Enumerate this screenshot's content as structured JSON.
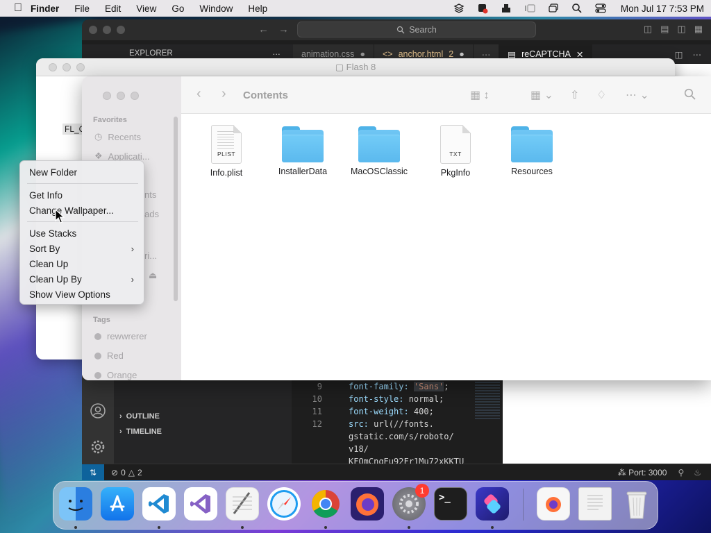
{
  "menubar": {
    "app": "Finder",
    "items": [
      "File",
      "Edit",
      "View",
      "Go",
      "Window",
      "Help"
    ],
    "clock": "Mon Jul 17  7:53 PM"
  },
  "vscode": {
    "search_placeholder": "Search",
    "explorer_label": "EXPLORER",
    "tabs": [
      {
        "label": "animation.css"
      },
      {
        "label": "anchor.html",
        "badge": "2"
      },
      {
        "label": "reCAPTCHA"
      }
    ],
    "sections": {
      "outline": "OUTLINE",
      "timeline": "TIMELINE"
    },
    "code": [
      {
        "ln": "9",
        "prop": "font-family: ",
        "val": "'Sans'",
        "tail": ";"
      },
      {
        "ln": "10",
        "prop": "font-style: ",
        "val": "normal;"
      },
      {
        "ln": "11",
        "prop": "font-weight: ",
        "val": "400;"
      },
      {
        "ln": "12",
        "prop": "src: ",
        "val": "url(//fonts."
      },
      {
        "ln": "",
        "prop": "",
        "val": "gstatic.com/s/roboto/"
      },
      {
        "ln": "",
        "prop": "",
        "val": "v18/"
      },
      {
        "ln": "",
        "prop": "",
        "val": "KFOmCnqEu92Fr1Mu72xKKTU"
      }
    ],
    "status": {
      "errors": "0",
      "warnings": "2",
      "port": "Port: 3000"
    }
  },
  "flash": {
    "title": "Flash 8",
    "fragment": "FL_C"
  },
  "finder": {
    "location": "Contents",
    "sidebar": {
      "favorites_heading": "Favorites",
      "favorites": [
        "Recents",
        "Applicati..."
      ],
      "partials": [
        "nts",
        "ads",
        "ri..."
      ],
      "tags_heading": "Tags",
      "tags": [
        "rewwrerer",
        "Red",
        "Orange"
      ]
    },
    "files": [
      {
        "name": "Info.plist",
        "kind": "doc",
        "tag": "PLIST"
      },
      {
        "name": "InstallerData",
        "kind": "folder"
      },
      {
        "name": "MacOSClassic",
        "kind": "folder"
      },
      {
        "name": "PkgInfo",
        "kind": "doc",
        "tag": "TXT"
      },
      {
        "name": "Resources",
        "kind": "folder"
      }
    ]
  },
  "context_menu": {
    "items": [
      {
        "label": "New Folder"
      },
      {
        "label": "Get Info"
      },
      {
        "label": "Change Wallpaper..."
      },
      {
        "label": "Use Stacks"
      },
      {
        "label": "Sort By",
        "submenu": true
      },
      {
        "label": "Clean Up"
      },
      {
        "label": "Clean Up By",
        "submenu": true
      },
      {
        "label": "Show View Options"
      }
    ]
  },
  "dock": {
    "apps": [
      {
        "name": "finder-icon",
        "color": "#3d8fe6"
      },
      {
        "name": "app-store-icon",
        "color": "#1d8cf5"
      },
      {
        "name": "vscode-icon",
        "color": "#ffffff"
      },
      {
        "name": "visual-studio-icon",
        "color": "#ffffff"
      },
      {
        "name": "textedit-icon",
        "color": "#f2f2f2"
      },
      {
        "name": "safari-icon",
        "color": "#e8f2fb"
      },
      {
        "name": "chrome-icon",
        "color": "#ffffff"
      },
      {
        "name": "firefox-icon",
        "color": "#2a1e6b"
      },
      {
        "name": "system-settings-icon",
        "color": "#8e8e93",
        "badge": "1"
      },
      {
        "name": "terminal-icon",
        "color": "#1e1e1e",
        "glyph": ">_"
      },
      {
        "name": "shortcuts-icon",
        "color": "#3f3ad6"
      },
      {
        "name": "firefox-doc-icon",
        "color": "#f7f7f7"
      },
      {
        "name": "document-stack-icon",
        "color": "#f2f2f2"
      },
      {
        "name": "trash-icon",
        "color": "#dcdcdc"
      }
    ]
  }
}
